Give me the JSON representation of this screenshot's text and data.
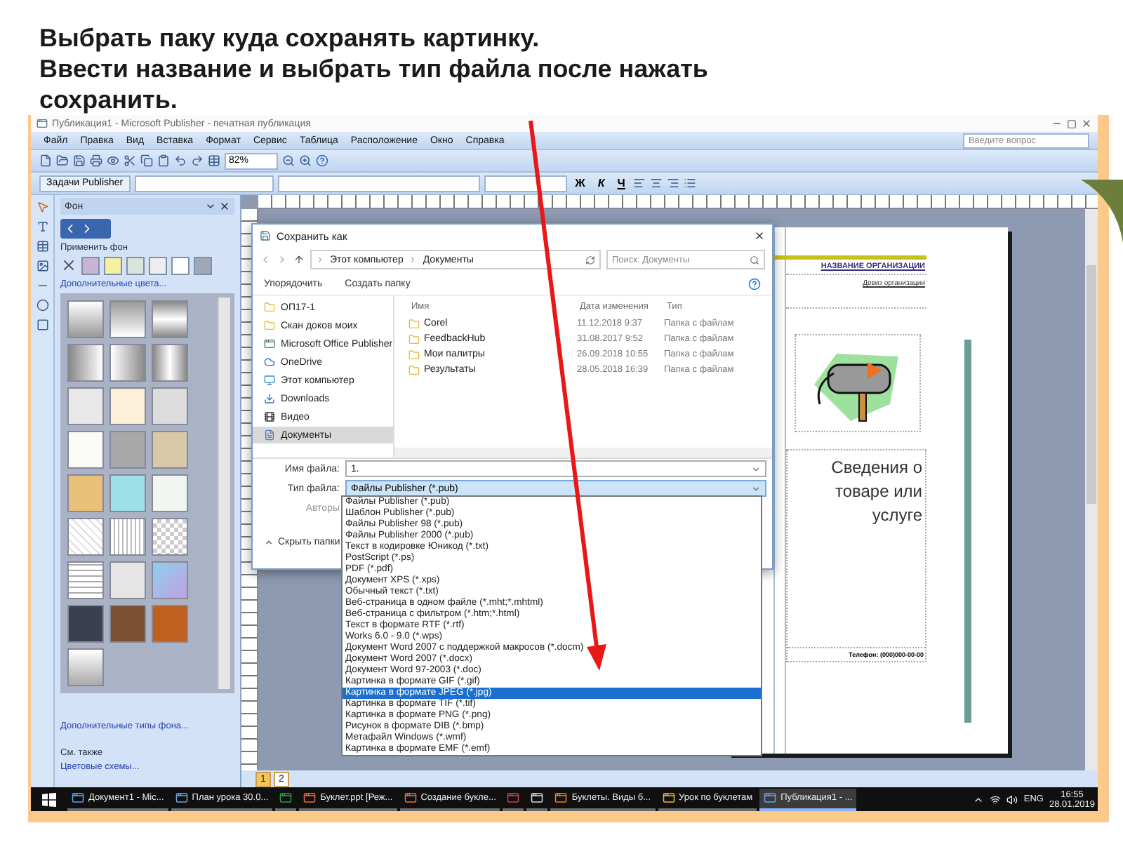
{
  "heading": [
    "Выбрать паку куда сохранять картинку.",
    "Ввести название и выбрать тип файла после нажать сохранить."
  ],
  "app": {
    "title": "Публикация1 - Microsoft Publisher - печатная публикация",
    "menu": [
      "Файл",
      "Правка",
      "Вид",
      "Вставка",
      "Формат",
      "Сервис",
      "Таблица",
      "Расположение",
      "Окно",
      "Справка"
    ],
    "help_placeholder": "Введите вопрос",
    "zoom": "82%",
    "tasks_button": "Задачи Publisher",
    "format_buttons": [
      "Ж",
      "К",
      "Ч"
    ]
  },
  "task_pane": {
    "title": "Фон",
    "apply_label": "Применить фон",
    "swatches": [
      {
        "color": "#c8b4d4"
      },
      {
        "color": "#f3f0a0"
      },
      {
        "color": "#d8e4dc"
      },
      {
        "color": "#eeeeee"
      },
      {
        "color": "#ffffff"
      },
      {
        "color": "#a0a8b8"
      }
    ],
    "more_colors": "Дополнительные цвета...",
    "more_types": "Дополнительные типы фона...",
    "see_also": "См. также",
    "color_schemes": "Цветовые схемы..."
  },
  "dialog": {
    "title": "Сохранить как",
    "path": [
      "Этот компьютер",
      "Документы"
    ],
    "search_placeholder": "Поиск: Документы",
    "organize": "Упорядочить",
    "new_folder": "Создать папку",
    "nav": [
      {
        "label": "ОП17-1",
        "kind": "folder",
        "selected": false
      },
      {
        "label": "Скан доков моих",
        "kind": "folder",
        "selected": false
      },
      {
        "label": "Microsoft Office Publisher",
        "kind": "app",
        "selected": false
      },
      {
        "label": "OneDrive",
        "kind": "cloud",
        "selected": false
      },
      {
        "label": "Этот компьютер",
        "kind": "computer",
        "selected": false
      },
      {
        "label": "Downloads",
        "kind": "download",
        "selected": false
      },
      {
        "label": "Видео",
        "kind": "video",
        "selected": false
      },
      {
        "label": "Документы",
        "kind": "document",
        "selected": true
      }
    ],
    "columns": [
      "Имя",
      "Дата изменения",
      "Тип"
    ],
    "files": [
      {
        "name": "Corel",
        "date": "11.12.2018 9:37",
        "type": "Папка с файлам"
      },
      {
        "name": "FeedbackHub",
        "date": "31.08.2017 9:52",
        "type": "Папка с файлам"
      },
      {
        "name": "Мои палитры",
        "date": "26.09.2018 10:55",
        "type": "Папка с файлам"
      },
      {
        "name": "Результаты",
        "date": "28.05.2018 16:39",
        "type": "Папка с файлам"
      }
    ],
    "file_name_label": "Имя файла:",
    "file_name": "1.",
    "file_type_label": "Тип файла:",
    "file_type": "Файлы Publisher (*.pub)",
    "authors_label": "Авторы",
    "hide_folders": "Скрыть папки",
    "type_options": [
      {
        "label": "Файлы Publisher (*.pub)",
        "selected": false
      },
      {
        "label": "Шаблон Publisher (*.pub)",
        "selected": false
      },
      {
        "label": "Файлы Publisher 98 (*.pub)",
        "selected": false
      },
      {
        "label": "Файлы Publisher 2000 (*.pub)",
        "selected": false
      },
      {
        "label": "Текст в кодировке Юникод (*.txt)",
        "selected": false
      },
      {
        "label": "PostScript (*.ps)",
        "selected": false
      },
      {
        "label": "PDF (*.pdf)",
        "selected": false
      },
      {
        "label": "Документ XPS (*.xps)",
        "selected": false
      },
      {
        "label": "Обычный текст (*.txt)",
        "selected": false
      },
      {
        "label": "Веб-страница в одном файле (*.mht;*.mhtml)",
        "selected": false
      },
      {
        "label": "Веб-страница с фильтром (*.htm;*.html)",
        "selected": false
      },
      {
        "label": "Текст в формате RTF (*.rtf)",
        "selected": false
      },
      {
        "label": "Works 6.0 - 9.0 (*.wps)",
        "selected": false
      },
      {
        "label": "Документ Word 2007 с поддержкой макросов (*.docm)",
        "selected": false
      },
      {
        "label": "Документ Word 2007 (*.docx)",
        "selected": false
      },
      {
        "label": "Документ Word 97-2003 (*.doc)",
        "selected": false
      },
      {
        "label": "Картинка в формате GIF (*.gif)",
        "selected": false
      },
      {
        "label": "Картинка в формате JPEG (*.jpg)",
        "selected": true
      },
      {
        "label": "Картинка в формате TIF (*.tif)",
        "selected": false
      },
      {
        "label": "Картинка в формате PNG (*.png)",
        "selected": false
      },
      {
        "label": "Рисунок в формате DIB (*.bmp)",
        "selected": false
      },
      {
        "label": "Метафайл Windows (*.wmf)",
        "selected": false
      },
      {
        "label": "Картинка в формате EMF (*.emf)",
        "selected": false
      }
    ]
  },
  "publication": {
    "org_name": "НАЗВАНИЕ ОРГАНИЗАЦИИ",
    "motto": "Девиз организации",
    "heading": "Сведения о товаре или услуге",
    "phone": "Телефон: (000)000-00-00"
  },
  "pages": [
    {
      "label": "1",
      "selected": true
    },
    {
      "label": "2",
      "selected": false
    }
  ],
  "taskbar": {
    "items": [
      {
        "label": "Документ1 - Mic...",
        "selected": false
      },
      {
        "label": "План урока 30.0...",
        "selected": false
      },
      {
        "selected": false
      },
      {
        "label": "Буклет.ppt [Реж...",
        "selected": false
      },
      {
        "label": "Создание букле...",
        "selected": false
      },
      {
        "selected": false
      },
      {
        "selected": false
      },
      {
        "label": "Буклеты. Виды б...",
        "selected": false
      },
      {
        "label": "Урок по буклетам",
        "selected": false
      },
      {
        "label": "Публикация1 - ...",
        "selected": true
      }
    ],
    "language": "ENG",
    "time": "16:55",
    "date": "28.01.2019"
  }
}
